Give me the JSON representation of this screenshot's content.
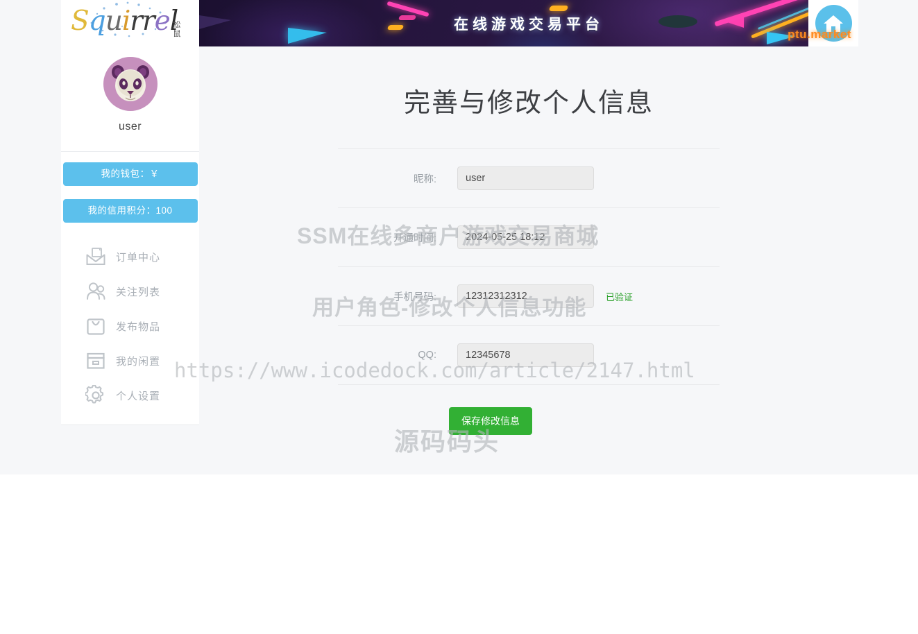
{
  "header": {
    "logo_letters": [
      "S",
      "q",
      "u",
      "i",
      "r",
      "r",
      "e",
      "l"
    ],
    "logo_cn_top": "松",
    "logo_cn_bottom": "鼠",
    "banner_title": "在线游戏交易平台",
    "banner_brand": "ptu.market",
    "home_icon": "home-icon"
  },
  "sidebar": {
    "avatar_icon": "panda-avatar",
    "username": "user",
    "wallet_label": "我的钱包：￥",
    "credit_label": "我的信用积分：100",
    "items": [
      {
        "label": "订单中心",
        "icon": "envelope-document-icon"
      },
      {
        "label": "关注列表",
        "icon": "users-icon"
      },
      {
        "label": "发布物品",
        "icon": "shopping-bag-icon"
      },
      {
        "label": "我的闲置",
        "icon": "box-icon"
      },
      {
        "label": "个人设置",
        "icon": "gear-icon"
      }
    ]
  },
  "main": {
    "title": "完善与修改个人信息",
    "fields": [
      {
        "label": "昵称:",
        "value": "user",
        "badge": ""
      },
      {
        "label": "开通时间:",
        "value": "2024-05-25 18:12",
        "badge": ""
      },
      {
        "label": "手机号码:",
        "value": "12312312312",
        "badge": "已验证"
      },
      {
        "label": "QQ:",
        "value": "12345678",
        "badge": ""
      }
    ],
    "save_label": "保存修改信息"
  },
  "watermarks": {
    "line1": "SSM在线多商户游戏交易商城",
    "line2": "用户角色-修改个人信息功能",
    "url": "https://www.icodedock.com/article/2147.html",
    "brand": "源码码头"
  },
  "colors": {
    "accent_blue": "#5cc0ec",
    "save_green": "#32b034",
    "verified_green": "#2aa02a",
    "brand_orange": "#ff8a1e",
    "avatar_bg": "#c690bd"
  }
}
